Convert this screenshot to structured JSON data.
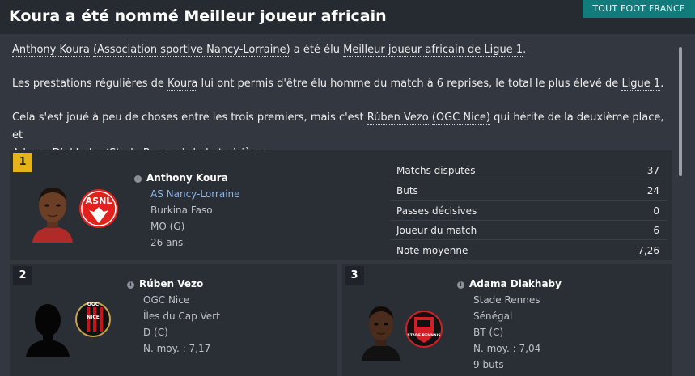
{
  "header": {
    "title": "Koura a été nommé Meilleur joueur africain",
    "source": "TOUT FOOT FRANCE"
  },
  "article": {
    "p1": {
      "a": "Anthony Koura",
      "b": " ",
      "c": "(Association sportive Nancy-Lorraine)",
      "d": " a été élu ",
      "e": "Meilleur joueur africain de Ligue 1",
      "f": "."
    },
    "p2": {
      "a": "Les prestations régulières de ",
      "b": "Koura",
      "c": " lui ont permis d'être élu homme du match à 6 reprises, le total le plus élevé de ",
      "d": "Ligue 1",
      "e": "."
    },
    "p3": {
      "a": "Cela s'est joué à peu de choses entre les trois premiers, mais c'est ",
      "b": "Rúben Vezo",
      "c": " ",
      "d": "(OGC Nice)",
      "e": " qui hérite de la deuxième place, et",
      "f": "Adama Diakhaby",
      "g": " ",
      "h": "(Stade Rennes)",
      "i": " de la troisième."
    }
  },
  "winner": {
    "rank": "1",
    "name": "Anthony Koura",
    "club": "AS Nancy-Lorraine",
    "nation": "Burkina Faso",
    "position": "MO (G)",
    "age": "26 ans",
    "crest_text": "ASNL",
    "crest_color": "#e2211c",
    "stats": [
      {
        "label": "Matchs disputés",
        "value": "37"
      },
      {
        "label": "Buts",
        "value": "24"
      },
      {
        "label": "Passes décisives",
        "value": "0"
      },
      {
        "label": "Joueur du match",
        "value": "6"
      },
      {
        "label": "Note moyenne",
        "value": "7,26"
      }
    ]
  },
  "second": {
    "rank": "2",
    "name": "Rúben Vezo",
    "club": "OGC Nice",
    "nation": "Îles du Cap Vert",
    "position": "D (C)",
    "rating": "N. moy. : 7,17",
    "crest_text": "OGC NICE"
  },
  "third": {
    "rank": "3",
    "name": "Adama Diakhaby",
    "club": "Stade Rennes",
    "nation": "Sénégal",
    "position": "BT (C)",
    "rating": "N. moy. : 7,04",
    "goals": "9 buts",
    "crest_text": "STADE RENNAIS"
  }
}
